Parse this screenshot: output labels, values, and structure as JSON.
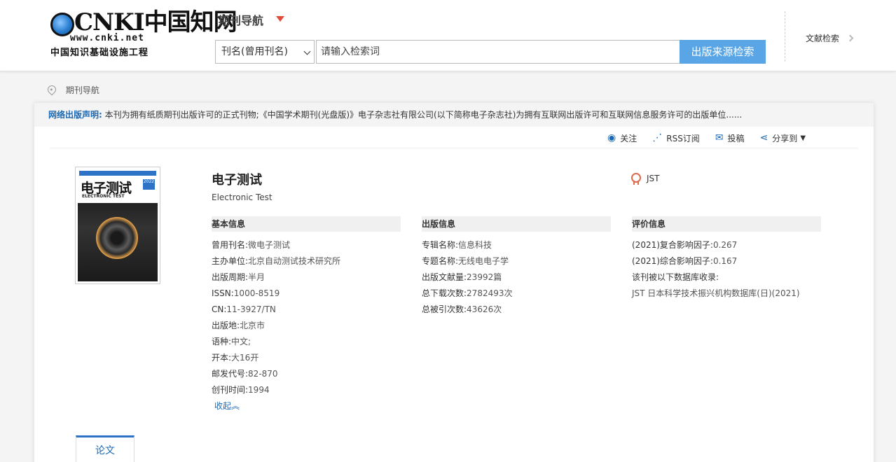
{
  "header": {
    "logo": {
      "main_text": "CNKI中国知网",
      "url": "www.cnki.net",
      "subtitle": "中国知识基础设施工程"
    },
    "nav_title": "期刊导航",
    "search": {
      "select_value": "刊名(曾用刊名)",
      "placeholder": "请输入检索词",
      "button_label": "出版来源检索"
    },
    "doc_search": "文献检索"
  },
  "breadcrumb": "期刊导航",
  "notice": {
    "label": "网络出版声明:",
    "text": "本刊为拥有纸质期刊出版许可的正式刊物;《中国学术期刊(光盘版)》电子杂志社有限公司(以下简称电子杂志社)为拥有互联网出版许可和互联网信息服务许可的出版单位......"
  },
  "actions": {
    "follow": "关注",
    "rss": "RSS订阅",
    "submit": "投稿",
    "share": "分享到"
  },
  "cover": {
    "title": "电子测试",
    "en": "ELECTRONIC TEST",
    "year": "2022"
  },
  "journal": {
    "title": "电子测试",
    "english_title": "Electronic Test",
    "badge": "JST"
  },
  "basic_info": {
    "heading": "基本信息",
    "rows": [
      {
        "label": "曾用刊名:",
        "value": "微电子测试"
      },
      {
        "label": "主办单位:",
        "value": "北京自动测试技术研究所"
      },
      {
        "label": "出版周期:",
        "value": "半月"
      },
      {
        "label": "ISSN:",
        "value": "1000-8519"
      },
      {
        "label": "CN:",
        "value": "11-3927/TN"
      },
      {
        "label": "出版地:",
        "value": "北京市"
      },
      {
        "label": "语种:",
        "value": "中文;"
      },
      {
        "label": "开本:",
        "value": "大16开"
      },
      {
        "label": "邮发代号:",
        "value": "82-870"
      },
      {
        "label": "创刊时间:",
        "value": "1994"
      }
    ],
    "collapse": "收起︽"
  },
  "publish_info": {
    "heading": "出版信息",
    "rows": [
      {
        "label": "专辑名称:",
        "value": "信息科技"
      },
      {
        "label": "专题名称:",
        "value": "无线电电子学"
      },
      {
        "label": "出版文献量:",
        "value": "23992篇"
      },
      {
        "label": "总下载次数:",
        "value": "2782493次"
      },
      {
        "label": "总被引次数:",
        "value": "43626次"
      }
    ]
  },
  "eval_info": {
    "heading": "评价信息",
    "rows": [
      {
        "label": "(2021)复合影响因子:",
        "value": "0.267"
      },
      {
        "label": "(2021)综合影响因子:",
        "value": "0.167"
      },
      {
        "label": "该刊被以下数据库收录:",
        "value": ""
      },
      {
        "label": "JST 日本科学技术振兴机构数据库(日)(2021)",
        "value": ""
      }
    ]
  },
  "tabs": [
    "论文"
  ],
  "colors": {
    "accent_blue": "#5aa5e6",
    "link_blue": "#1b68b3",
    "arrow_red": "#e04b3a"
  }
}
